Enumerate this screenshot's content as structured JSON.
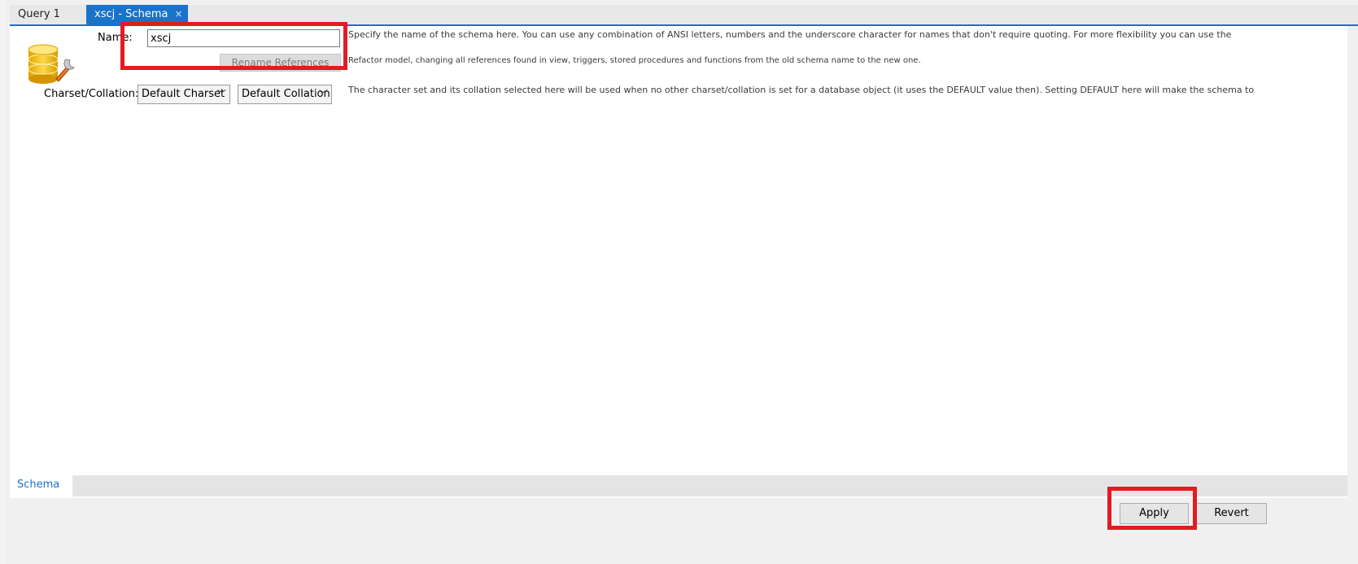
{
  "tabs": [
    {
      "label": "Query 1",
      "active": false
    },
    {
      "label": "xscj - Schema",
      "active": true,
      "close_glyph": "×"
    }
  ],
  "schema_form": {
    "name_label": "Name:",
    "name_value": "xscj",
    "rename_button": "Rename References",
    "charset_label": "Charset/Collation:",
    "charset_selected": "Default Charset",
    "collation_selected": "Default Collation",
    "name_help_line1": "Specify the name of the schema here. You can use any combination of ANSI letters, numbers and the underscore character for names that don't require quoting. For more flexibility you can use the",
    "name_help_line2": "Refactor model, changing all references found in view, triggers, stored procedures and functions from the old schema name to the new one.",
    "charset_help": "The character set and its collation selected here will be used when no other charset/collation is set for a database object (it uses the DEFAULT value then). Setting DEFAULT here will make the schema to"
  },
  "subtabs": [
    {
      "label": "Schema",
      "active": true
    }
  ],
  "footer": {
    "apply_label": "Apply",
    "revert_label": "Revert"
  },
  "icons": {
    "schema_icon": "database-wrench-icon",
    "chevron": "chevron-down-icon",
    "close": "close-icon"
  },
  "colors": {
    "accent": "#1a73c9",
    "highlight": "#e31b23"
  }
}
